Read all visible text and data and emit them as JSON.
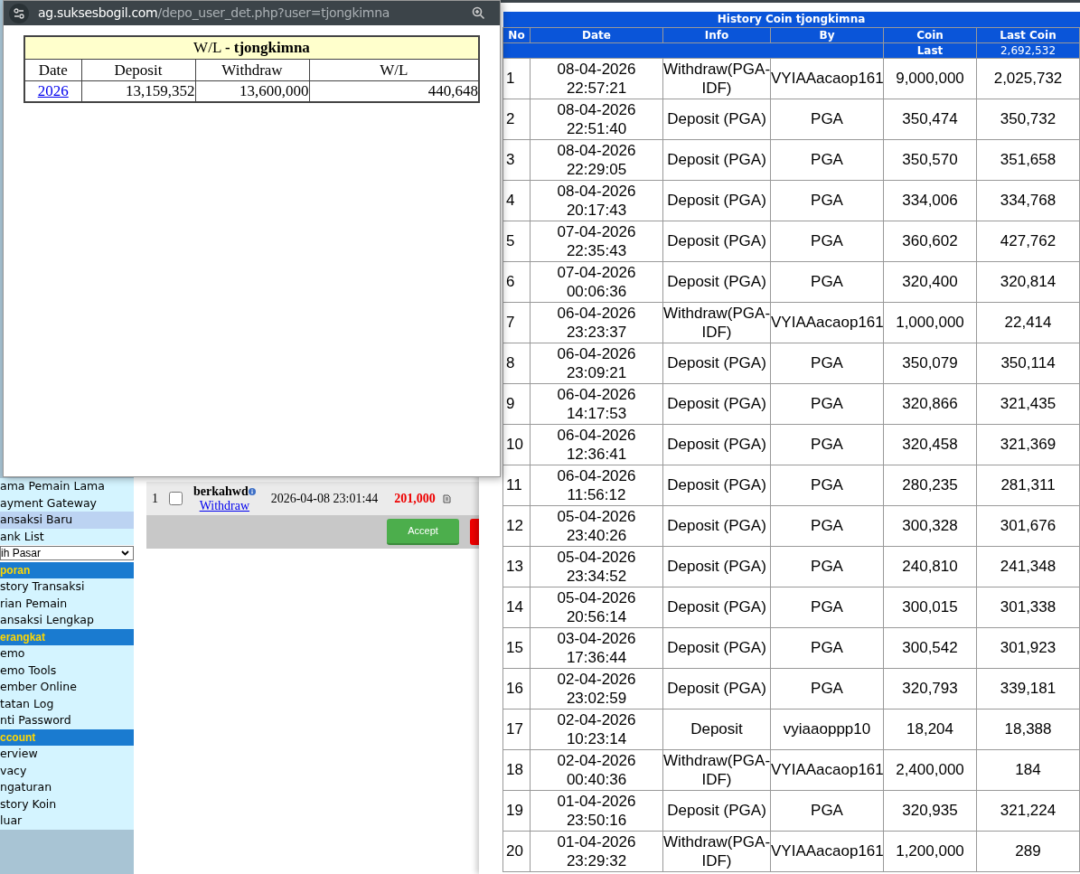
{
  "popup": {
    "url_host": "ag.suksesbogil.com",
    "url_path": "/depo_user_det.php?user=tjongkimna",
    "title": "W/L **- tjongkimna**",
    "columns": [
      "Date",
      "Deposit",
      "Withdraw",
      "W/L"
    ],
    "rows": [
      {
        "date": "2026",
        "deposit": "13,159,352",
        "withdraw": "13,600,000",
        "wl": "440,648"
      }
    ]
  },
  "sidebar": {
    "items": [
      {
        "kind": "item",
        "label": "ama Pemain Lama",
        "selected": false
      },
      {
        "kind": "item",
        "label": "ayment Gateway",
        "selected": false
      },
      {
        "kind": "item",
        "label": "ansaksi Baru",
        "selected": true
      },
      {
        "kind": "item",
        "label": "ank List",
        "selected": false
      },
      {
        "kind": "select",
        "label": "ih Pasar"
      },
      {
        "kind": "header",
        "label": "poran"
      },
      {
        "kind": "item",
        "label": "story Transaksi",
        "selected": false
      },
      {
        "kind": "item",
        "label": "rian Pemain",
        "selected": false
      },
      {
        "kind": "item",
        "label": "ansaksi Lengkap",
        "selected": false
      },
      {
        "kind": "header",
        "label": "erangkat"
      },
      {
        "kind": "item",
        "label": "emo",
        "selected": false
      },
      {
        "kind": "item",
        "label": "emo Tools",
        "selected": false
      },
      {
        "kind": "item",
        "label": "ember Online",
        "selected": false
      },
      {
        "kind": "item",
        "label": "tatan Log",
        "selected": false
      },
      {
        "kind": "item",
        "label": "nti Password",
        "selected": false
      },
      {
        "kind": "header",
        "label": "ccount"
      },
      {
        "kind": "item",
        "label": "erview",
        "selected": false
      },
      {
        "kind": "item",
        "label": "vacy",
        "selected": false
      },
      {
        "kind": "item",
        "label": "ngaturan",
        "selected": false
      },
      {
        "kind": "item",
        "label": "story Koin",
        "selected": false
      },
      {
        "kind": "item",
        "label": "luar",
        "selected": false
      }
    ]
  },
  "transaction": {
    "no": "1",
    "checked": false,
    "user": "berkahwd",
    "type": "Withdraw",
    "time": "2026-04-08 23:01:44",
    "amount": "201,000",
    "accept": "Accept"
  },
  "history": {
    "title": "History Coin tjongkimna",
    "columns": [
      "No",
      "Date",
      "Info",
      "By",
      "Coin",
      "Last Coin"
    ],
    "last_label": "Last",
    "last_value": "2,692,532",
    "rows": [
      {
        "no": "1",
        "date": "08-04-2026",
        "time": "22:57:21",
        "info": "Withdraw(PGA-IDF)",
        "by": "VYIAAacaop161",
        "coin": "9,000,000",
        "last": "2,025,732"
      },
      {
        "no": "2",
        "date": "08-04-2026",
        "time": "22:51:40",
        "info": "Deposit (PGA)",
        "by": "PGA",
        "coin": "350,474",
        "last": "350,732"
      },
      {
        "no": "3",
        "date": "08-04-2026",
        "time": "22:29:05",
        "info": "Deposit (PGA)",
        "by": "PGA",
        "coin": "350,570",
        "last": "351,658"
      },
      {
        "no": "4",
        "date": "08-04-2026",
        "time": "20:17:43",
        "info": "Deposit (PGA)",
        "by": "PGA",
        "coin": "334,006",
        "last": "334,768"
      },
      {
        "no": "5",
        "date": "07-04-2026",
        "time": "22:35:43",
        "info": "Deposit (PGA)",
        "by": "PGA",
        "coin": "360,602",
        "last": "427,762"
      },
      {
        "no": "6",
        "date": "07-04-2026",
        "time": "00:06:36",
        "info": "Deposit (PGA)",
        "by": "PGA",
        "coin": "320,400",
        "last": "320,814"
      },
      {
        "no": "7",
        "date": "06-04-2026",
        "time": "23:23:37",
        "info": "Withdraw(PGA-IDF)",
        "by": "VYIAAacaop161",
        "coin": "1,000,000",
        "last": "22,414"
      },
      {
        "no": "8",
        "date": "06-04-2026",
        "time": "23:09:21",
        "info": "Deposit (PGA)",
        "by": "PGA",
        "coin": "350,079",
        "last": "350,114"
      },
      {
        "no": "9",
        "date": "06-04-2026",
        "time": "14:17:53",
        "info": "Deposit (PGA)",
        "by": "PGA",
        "coin": "320,866",
        "last": "321,435"
      },
      {
        "no": "10",
        "date": "06-04-2026",
        "time": "12:36:41",
        "info": "Deposit (PGA)",
        "by": "PGA",
        "coin": "320,458",
        "last": "321,369"
      },
      {
        "no": "11",
        "date": "06-04-2026",
        "time": "11:56:12",
        "info": "Deposit (PGA)",
        "by": "PGA",
        "coin": "280,235",
        "last": "281,311"
      },
      {
        "no": "12",
        "date": "05-04-2026",
        "time": "23:40:26",
        "info": "Deposit (PGA)",
        "by": "PGA",
        "coin": "300,328",
        "last": "301,676"
      },
      {
        "no": "13",
        "date": "05-04-2026",
        "time": "23:34:52",
        "info": "Deposit (PGA)",
        "by": "PGA",
        "coin": "240,810",
        "last": "241,348"
      },
      {
        "no": "14",
        "date": "05-04-2026",
        "time": "20:56:14",
        "info": "Deposit (PGA)",
        "by": "PGA",
        "coin": "300,015",
        "last": "301,338"
      },
      {
        "no": "15",
        "date": "03-04-2026",
        "time": "17:36:44",
        "info": "Deposit (PGA)",
        "by": "PGA",
        "coin": "300,542",
        "last": "301,923"
      },
      {
        "no": "16",
        "date": "02-04-2026",
        "time": "23:02:59",
        "info": "Deposit (PGA)",
        "by": "PGA",
        "coin": "320,793",
        "last": "339,181"
      },
      {
        "no": "17",
        "date": "02-04-2026",
        "time": "10:23:14",
        "info": "Deposit",
        "by": "vyiaaoppp10",
        "coin": "18,204",
        "last": "18,388"
      },
      {
        "no": "18",
        "date": "02-04-2026",
        "time": "00:40:36",
        "info": "Withdraw(PGA-IDF)",
        "by": "VYIAAacaop161",
        "coin": "2,400,000",
        "last": "184"
      },
      {
        "no": "19",
        "date": "01-04-2026",
        "time": "23:50:16",
        "info": "Deposit (PGA)",
        "by": "PGA",
        "coin": "320,935",
        "last": "321,224"
      },
      {
        "no": "20",
        "date": "01-04-2026",
        "time": "23:29:32",
        "info": "Withdraw(PGA-IDF)",
        "by": "VYIAAacaop161",
        "coin": "1,200,000",
        "last": "289"
      }
    ]
  }
}
